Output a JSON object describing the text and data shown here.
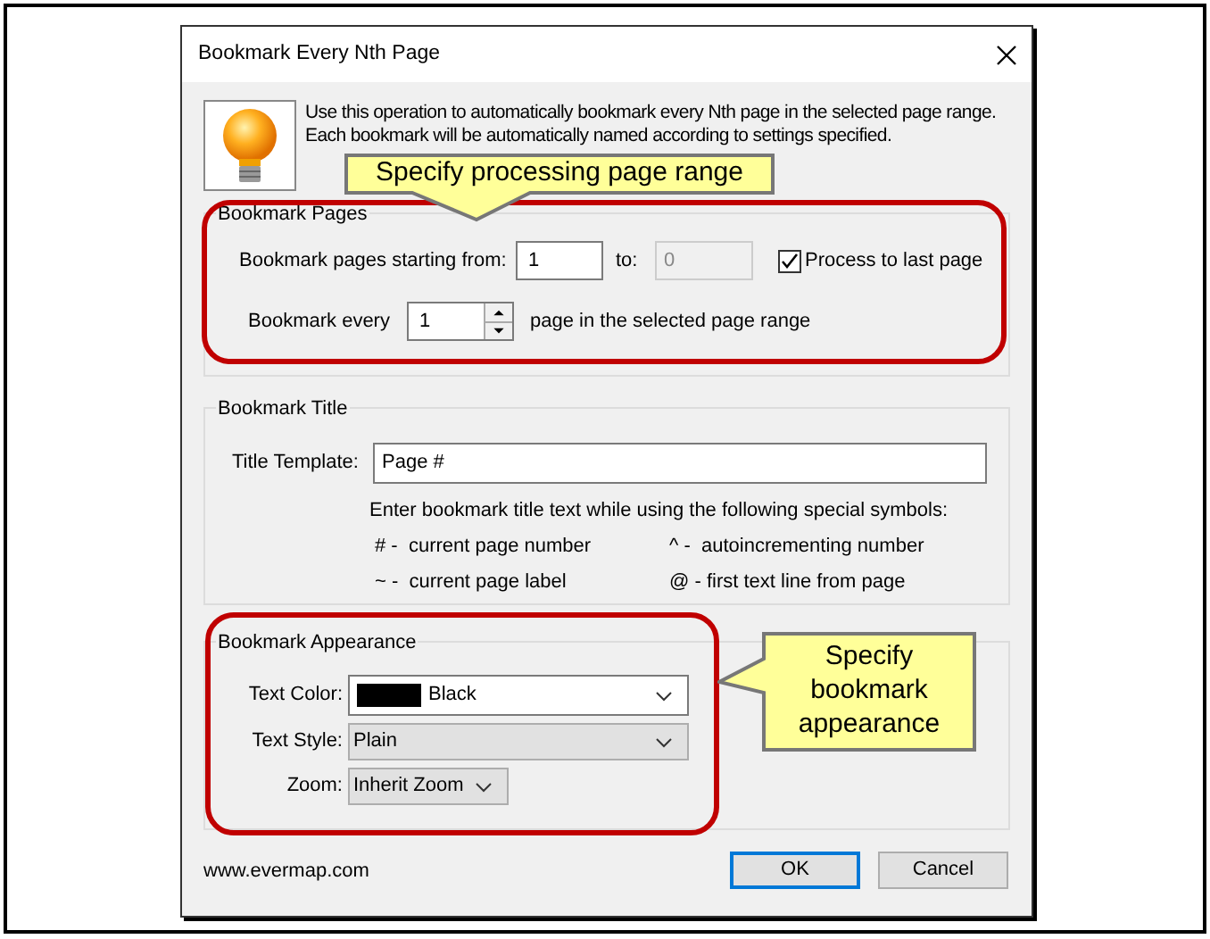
{
  "dialog": {
    "title": "Bookmark Every Nth Page",
    "description": "Use this operation to automatically bookmark every Nth page in the selected page range.  Each bookmark will be automatically named according to settings specified."
  },
  "bookmark_pages": {
    "legend": "Bookmark Pages",
    "start_label": "Bookmark pages starting from:",
    "start_value": "1",
    "to_label": "to:",
    "to_value": "0",
    "to_disabled": true,
    "process_to_last": {
      "label": "Process to last page",
      "checked": true
    },
    "every_label": "Bookmark every",
    "every_value": "1",
    "every_suffix": "page in the selected page range"
  },
  "bookmark_title": {
    "legend": "Bookmark Title",
    "template_label": "Title Template:",
    "template_value": "Page #",
    "hint": "Enter bookmark title text while using the following special symbols:",
    "symbols": [
      "# -  current page number",
      "^ -  autoincrementing number",
      "~ -  current page label",
      "@ - first text line from page"
    ]
  },
  "bookmark_appearance": {
    "legend": "Bookmark Appearance",
    "fields": [
      {
        "kind": "color",
        "label": "Text Color:",
        "value": "Black",
        "color": "#000000"
      },
      {
        "kind": "list",
        "label": "Text Style:",
        "value": "Plain"
      },
      {
        "kind": "list",
        "label": "Zoom:",
        "value": "Inherit Zoom"
      }
    ]
  },
  "footer": {
    "link": "www.evermap.com",
    "buttons": [
      {
        "label": "OK",
        "default": true
      },
      {
        "label": "Cancel",
        "default": false
      }
    ]
  },
  "callouts": [
    "Specify processing page range",
    "Specify bookmark appearance"
  ]
}
